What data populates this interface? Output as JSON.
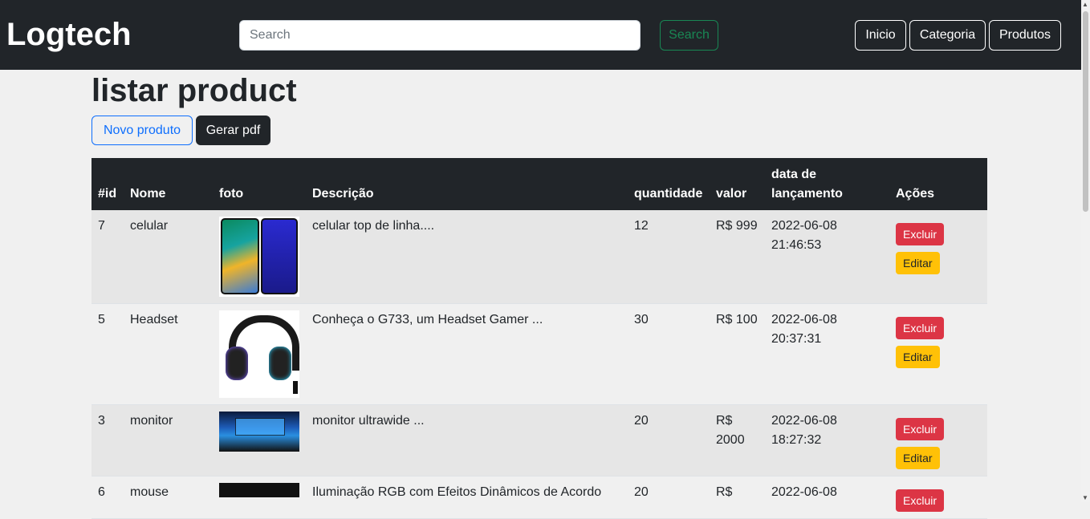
{
  "navbar": {
    "brand": "Logtech",
    "search_placeholder": "Search",
    "search_button": "Search",
    "links": [
      "Inicio",
      "Categoria",
      "Produtos"
    ]
  },
  "page": {
    "title": "listar product",
    "new_button": "Novo produto",
    "pdf_button": "Gerar pdf"
  },
  "table": {
    "headers": [
      "#id",
      "Nome",
      "foto",
      "Descrição",
      "quantidade",
      "valor",
      "data de lançamento",
      "Ações"
    ],
    "rows": [
      {
        "id": "7",
        "nome": "celular",
        "foto": "phone-image",
        "descricao": "celular top de linha....",
        "quantidade": "12",
        "valor": "R$ 999",
        "data": "2022-06-08 21:46:53"
      },
      {
        "id": "5",
        "nome": "Headset",
        "foto": "headset-image",
        "descricao": "Conheça o G733, um Headset Gamer ...",
        "quantidade": "30",
        "valor": "R$ 100",
        "data": "2022-06-08 20:37:31"
      },
      {
        "id": "3",
        "nome": "monitor",
        "foto": "monitor-image",
        "descricao": "monitor ultrawide ...",
        "quantidade": "20",
        "valor": "R$ 2000",
        "data": "2022-06-08 18:27:32"
      },
      {
        "id": "6",
        "nome": "mouse",
        "foto": "mouse-image",
        "descricao": "Iluminação RGB com Efeitos Dinâmicos de Acordo",
        "quantidade": "20",
        "valor": "R$",
        "data": "2022-06-08"
      }
    ],
    "delete_label": "Excluir",
    "edit_label": "Editar"
  },
  "colors": {
    "navbar": "#212529",
    "background": "#f0f0f0",
    "primary": "#0d6efd",
    "success": "#198754",
    "danger": "#dc3545",
    "warning": "#ffc107"
  }
}
